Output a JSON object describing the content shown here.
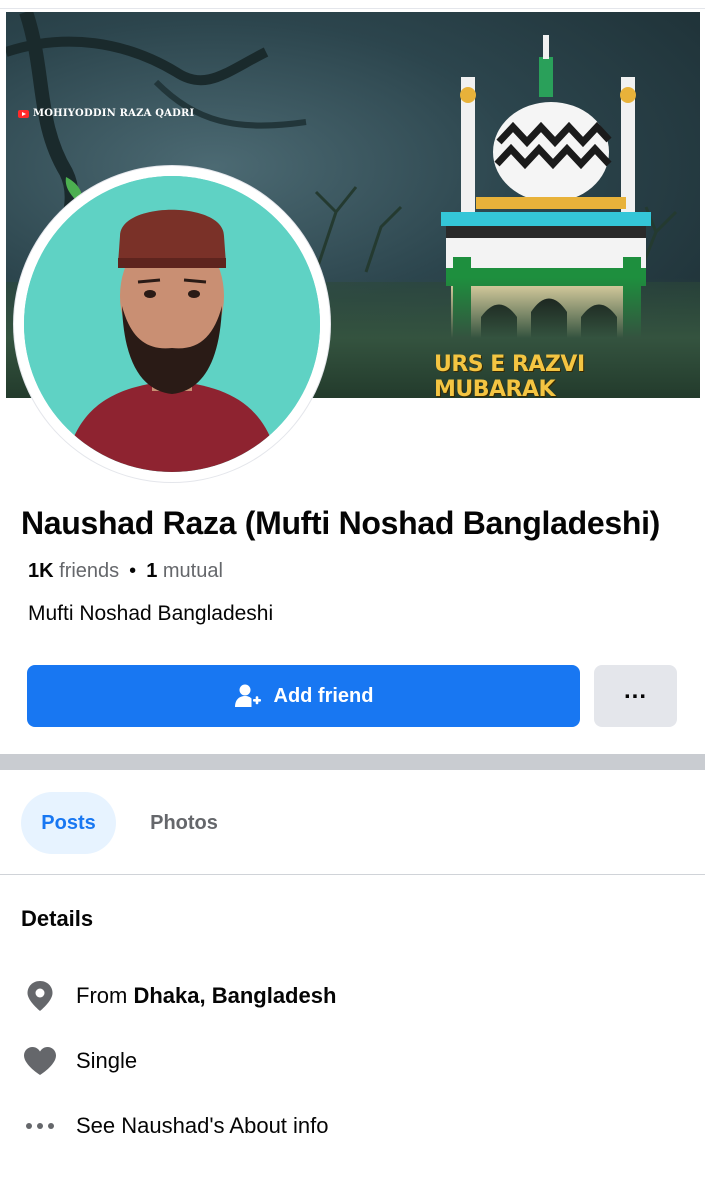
{
  "cover": {
    "watermark": "MOHIYODDIN RAZA QADRI",
    "banner_text": "URS E RAZVI MUBARAK"
  },
  "profile": {
    "name": "Naushad Raza (Mufti Noshad Bangladeshi)",
    "friends_count": "1K",
    "friends_label": "friends",
    "mutual_count": "1",
    "mutual_label": "mutual",
    "bio": "Mufti Noshad Bangladeshi"
  },
  "actions": {
    "add_friend_label": "Add friend",
    "more_label": "..."
  },
  "tabs": [
    {
      "label": "Posts",
      "active": true
    },
    {
      "label": "Photos",
      "active": false
    }
  ],
  "details": {
    "title": "Details",
    "from_prefix": "From",
    "from_place": "Dhaka, Bangladesh",
    "relationship": "Single",
    "about_link": "See Naushad's About info"
  },
  "icons": {
    "location": "location-pin-icon",
    "relationship": "heart-icon",
    "about": "more-dots-icon",
    "add_friend": "add-person-icon"
  },
  "colors": {
    "primary": "#1877f2",
    "tab_active_bg": "#e7f3ff",
    "secondary_text": "#65676b",
    "button_gray": "#e4e6eb"
  }
}
